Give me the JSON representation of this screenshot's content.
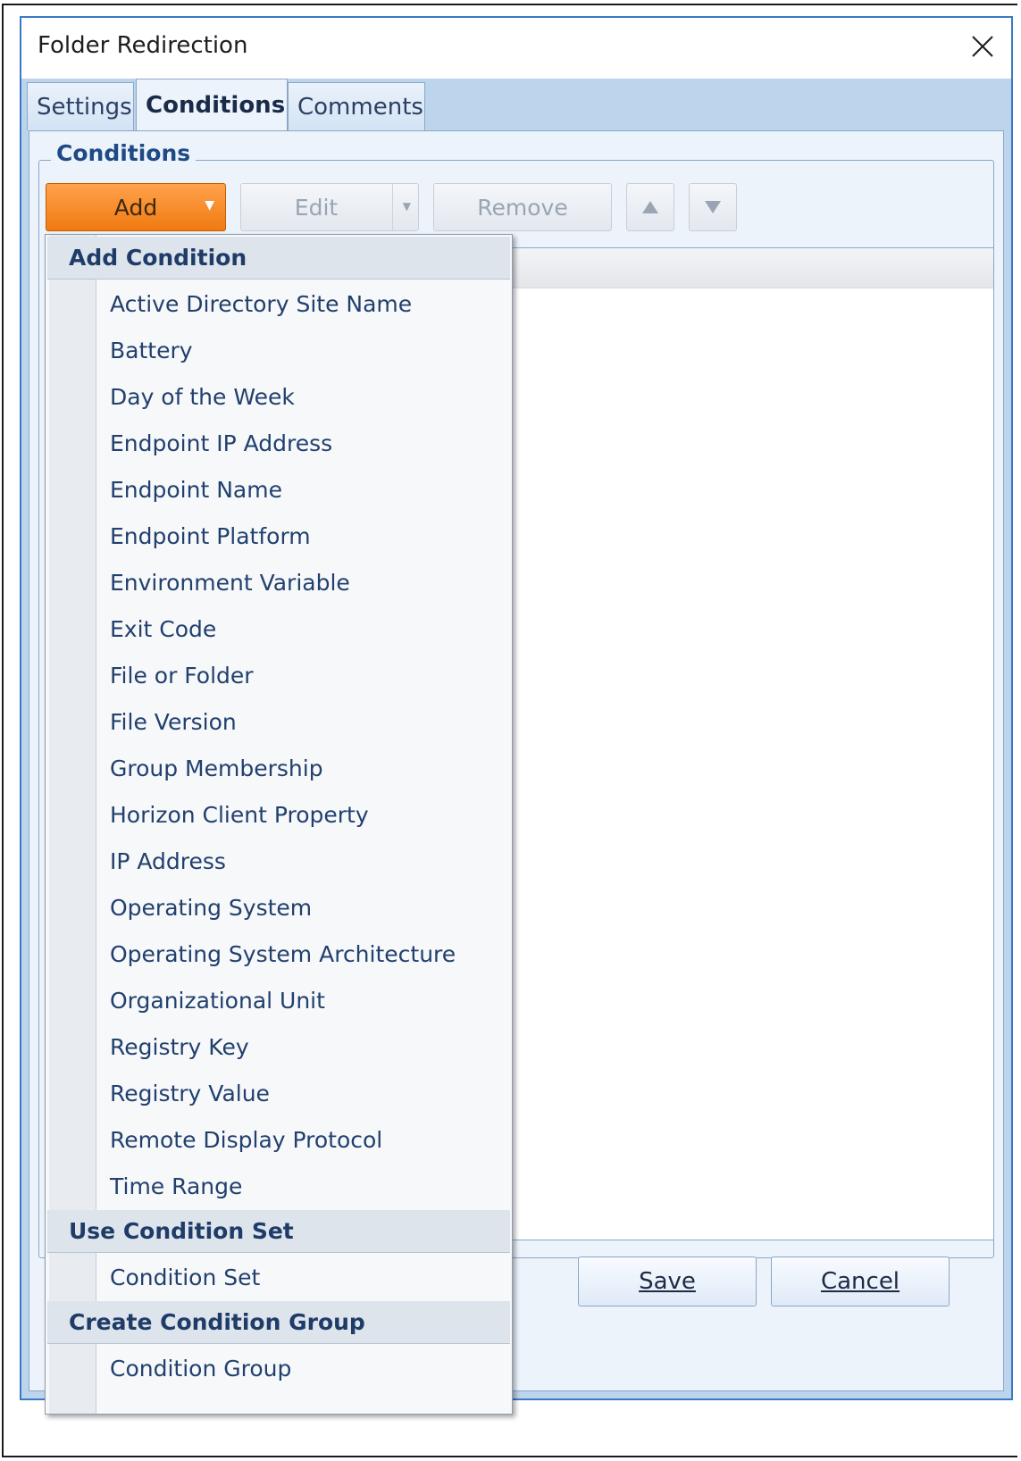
{
  "window": {
    "title": "Folder Redirection"
  },
  "tabs": [
    {
      "label": "Settings"
    },
    {
      "label": "Conditions"
    },
    {
      "label": "Comments"
    }
  ],
  "group": {
    "label": "Conditions"
  },
  "toolbar": {
    "add_label": "Add",
    "edit_label": "Edit",
    "remove_label": "Remove"
  },
  "menu": {
    "sections": [
      {
        "title": "Add Condition"
      },
      {
        "title": "Use Condition Set"
      },
      {
        "title": "Create Condition Group"
      }
    ],
    "add_items": [
      "Active Directory Site Name",
      "Battery",
      "Day of the Week",
      "Endpoint IP Address",
      "Endpoint Name",
      "Endpoint Platform",
      "Environment Variable",
      "Exit Code",
      "File or Folder",
      "File Version",
      "Group Membership",
      "Horizon Client Property",
      "IP Address",
      "Operating System",
      "Operating System Architecture",
      "Organizational Unit",
      "Registry Key",
      "Registry Value",
      "Remote Display Protocol",
      "Time Range"
    ],
    "set_items": [
      "Condition Set"
    ],
    "group_items": [
      "Condition Group"
    ]
  },
  "footer": {
    "save_label": "Save",
    "cancel_label": "Cancel"
  }
}
